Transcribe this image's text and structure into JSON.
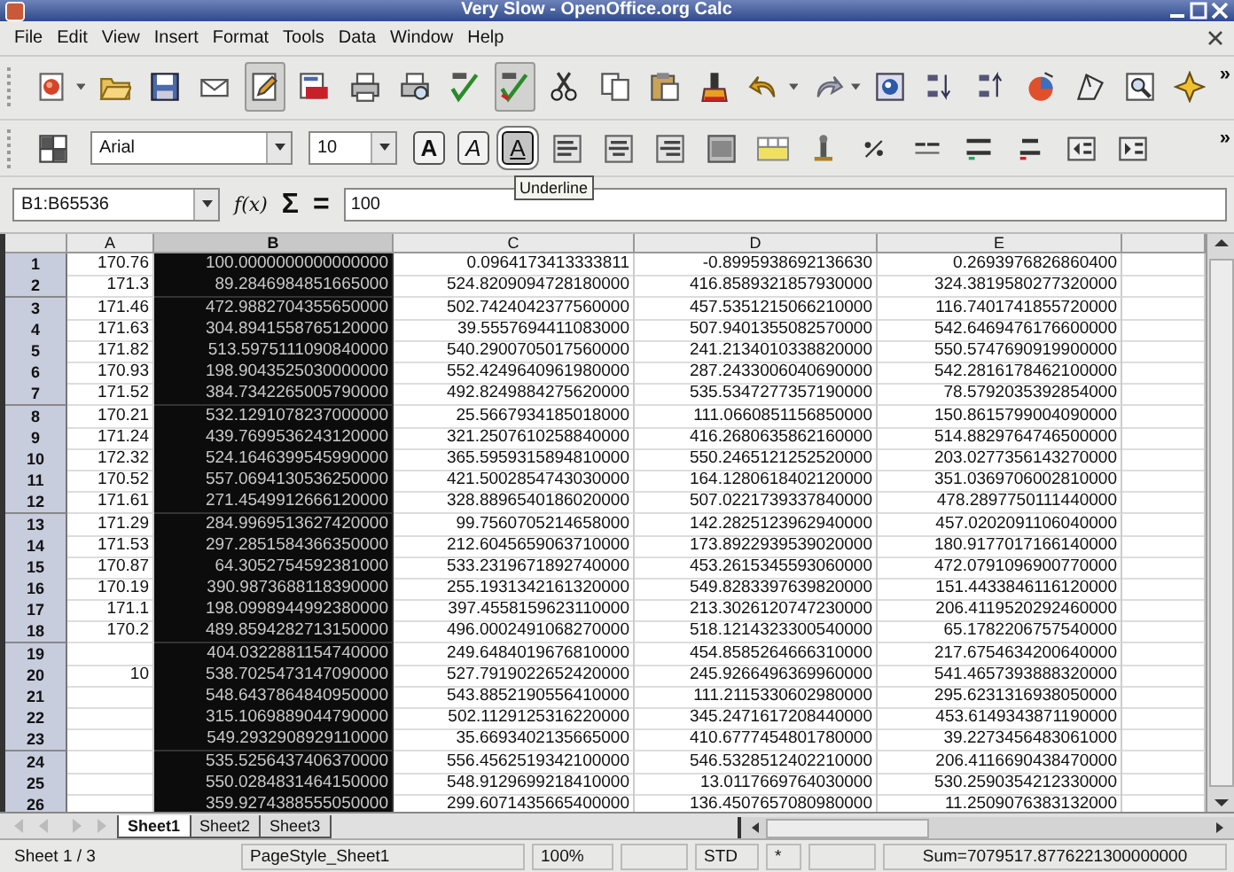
{
  "window": {
    "title": "Very Slow - OpenOffice.org Calc"
  },
  "menu": [
    "File",
    "Edit",
    "View",
    "Insert",
    "Format",
    "Tools",
    "Data",
    "Window",
    "Help"
  ],
  "standard_toolbar": {
    "buttons": [
      {
        "kind": "new",
        "pressed": false,
        "dropdown": true
      },
      {
        "kind": "open",
        "pressed": false,
        "dropdown": false
      },
      {
        "kind": "save",
        "pressed": false,
        "dropdown": false
      },
      {
        "kind": "mail",
        "pressed": false,
        "dropdown": false
      },
      {
        "kind": "edit",
        "pressed": true,
        "dropdown": false
      },
      {
        "kind": "pdf",
        "pressed": false,
        "dropdown": false
      },
      {
        "kind": "print",
        "pressed": false,
        "dropdown": false
      },
      {
        "kind": "preview",
        "pressed": false,
        "dropdown": false
      },
      {
        "kind": "spell",
        "pressed": false,
        "dropdown": false
      },
      {
        "kind": "autospell",
        "pressed": true,
        "dropdown": false
      },
      {
        "kind": "cut",
        "pressed": false,
        "dropdown": false
      },
      {
        "kind": "copy",
        "pressed": false,
        "dropdown": false
      },
      {
        "kind": "paste",
        "pressed": false,
        "dropdown": false
      },
      {
        "kind": "brush",
        "pressed": false,
        "dropdown": false
      },
      {
        "kind": "undo",
        "pressed": false,
        "dropdown": true
      },
      {
        "kind": "redo",
        "pressed": false,
        "dropdown": true
      },
      {
        "kind": "navigator",
        "pressed": false,
        "dropdown": false
      },
      {
        "kind": "sortasc",
        "pressed": false,
        "dropdown": false
      },
      {
        "kind": "sortdesc",
        "pressed": false,
        "dropdown": false
      },
      {
        "kind": "chart",
        "pressed": false,
        "dropdown": false
      },
      {
        "kind": "draw",
        "pressed": false,
        "dropdown": false
      },
      {
        "kind": "find",
        "pressed": false,
        "dropdown": false
      },
      {
        "kind": "gallery",
        "pressed": false,
        "dropdown": false
      }
    ],
    "overflow": "»"
  },
  "formatting_toolbar": {
    "font": "Arial",
    "size": "10",
    "text_buttons": [
      {
        "kind": "bold",
        "label": "A",
        "pressed": false
      },
      {
        "kind": "italic",
        "label": "A",
        "pressed": false
      },
      {
        "kind": "underline",
        "label": "A",
        "pressed": true
      }
    ],
    "buttons": [
      {
        "kind": "alignleft"
      },
      {
        "kind": "aligncenter"
      },
      {
        "kind": "alignright"
      },
      {
        "kind": "justify"
      },
      {
        "kind": "merge"
      },
      {
        "kind": "currency"
      },
      {
        "kind": "percent"
      },
      {
        "kind": "numformat"
      },
      {
        "kind": "adddecimal"
      },
      {
        "kind": "deldecimal"
      },
      {
        "kind": "outdent"
      },
      {
        "kind": "indent"
      }
    ],
    "overflow": "»"
  },
  "tooltip": "Underline",
  "formula_bar": {
    "name_box": "B1:B65536",
    "function_wizard": "f(x)",
    "sum": "Σ",
    "equals": "=",
    "formula": "100"
  },
  "sheet": {
    "columns": [
      {
        "label": "A",
        "selected": false
      },
      {
        "label": "B",
        "selected": true
      },
      {
        "label": "C",
        "selected": false
      },
      {
        "label": "D",
        "selected": false
      },
      {
        "label": "E",
        "selected": false
      }
    ],
    "rows": [
      {
        "header": "1",
        "cells": [
          "170.76",
          "100.0000000000000000",
          "0.0964173413333811",
          "-0.8995938692136630",
          "0.2693976826860400"
        ]
      },
      {
        "header": "2",
        "cells": [
          "171.3",
          "89.2846984851665000",
          "524.8209094728180000",
          "416.8589321857930000",
          "324.3819580277320000"
        ]
      },
      {
        "header": "3",
        "cells": [
          "171.46",
          "472.9882704355650000",
          "502.7424042377560000",
          "457.5351215066210000",
          "116.7401741855720000"
        ]
      },
      {
        "header": "4",
        "cells": [
          "171.63",
          "304.8941558765120000",
          "39.5557694411083000",
          "507.9401355082570000",
          "542.6469476176600000"
        ]
      },
      {
        "header": "5",
        "cells": [
          "171.82",
          "513.5975111090840000",
          "540.2900705017560000",
          "241.2134010338820000",
          "550.5747690919900000"
        ]
      },
      {
        "header": "6",
        "cells": [
          "170.93",
          "198.9043525030000000",
          "552.4249640961980000",
          "287.2433006040690000",
          "542.2816178462100000"
        ]
      },
      {
        "header": "7",
        "cells": [
          "171.52",
          "384.7342265005790000",
          "492.8249884275620000",
          "535.5347277357190000",
          "78.5792035392854000"
        ]
      },
      {
        "header": "8",
        "cells": [
          "170.21",
          "532.1291078237000000",
          "25.5667934185018000",
          "111.0660851156850000",
          "150.8615799004090000"
        ]
      },
      {
        "header": "9",
        "cells": [
          "171.24",
          "439.7699536243120000",
          "321.2507610258840000",
          "416.2680635862160000",
          "514.8829764746500000"
        ]
      },
      {
        "header": "10",
        "cells": [
          "172.32",
          "524.1646399545990000",
          "365.5959315894810000",
          "550.2465121252520000",
          "203.0277356143270000"
        ]
      },
      {
        "header": "11",
        "cells": [
          "170.52",
          "557.0694130536250000",
          "421.5002854743030000",
          "164.1280618402120000",
          "351.0369706002810000"
        ]
      },
      {
        "header": "12",
        "cells": [
          "171.61",
          "271.4549912666120000",
          "328.8896540186020000",
          "507.0221739337840000",
          "478.2897750111440000"
        ]
      },
      {
        "header": "13",
        "cells": [
          "171.29",
          "284.9969513627420000",
          "99.7560705214658000",
          "142.2825123962940000",
          "457.0202091106040000"
        ]
      },
      {
        "header": "14",
        "cells": [
          "171.53",
          "297.2851584366350000",
          "212.6045659063710000",
          "173.8922939539020000",
          "180.9177017166140000"
        ]
      },
      {
        "header": "15",
        "cells": [
          "170.87",
          "64.3052754592381000",
          "533.2319671892740000",
          "453.2615345593060000",
          "472.0791096900770000"
        ]
      },
      {
        "header": "16",
        "cells": [
          "170.19",
          "390.9873688118390000",
          "255.1931342161320000",
          "549.8283397639820000",
          "151.4433846116120000"
        ]
      },
      {
        "header": "17",
        "cells": [
          "171.1",
          "198.0998944992380000",
          "397.4558159623110000",
          "213.3026120747230000",
          "206.4119520292460000"
        ]
      },
      {
        "header": "18",
        "cells": [
          "170.2",
          "489.8594282713150000",
          "496.0002491068270000",
          "518.1214323300540000",
          "65.1782206757540000"
        ]
      },
      {
        "header": "19",
        "cells": [
          null,
          "404.0322881154740000",
          "249.6484019676810000",
          "454.8585264666310000",
          "217.6754634200640000"
        ]
      },
      {
        "header": "20",
        "cells": [
          "10",
          "538.7025473147090000",
          "527.7919022652420000",
          "245.9266496369960000",
          "541.4657393888320000"
        ]
      },
      {
        "header": "21",
        "cells": [
          null,
          "548.6437864840950000",
          "543.8852190556410000",
          "111.2115330602980000",
          "295.6231316938050000"
        ]
      },
      {
        "header": "22",
        "cells": [
          null,
          "315.1069889044790000",
          "502.1129125316220000",
          "345.2471617208440000",
          "453.6149343871190000"
        ]
      },
      {
        "header": "23",
        "cells": [
          null,
          "549.2932908929110000",
          "35.6693402135665000",
          "410.6777454801780000",
          "39.2273456483061000"
        ]
      },
      {
        "header": "24",
        "cells": [
          null,
          "535.5256437406370000",
          "556.4562519342100000",
          "546.5328512402210000",
          "206.4116690438470000"
        ]
      },
      {
        "header": "25",
        "cells": [
          null,
          "550.0284831464150000",
          "548.9129699218410000",
          "13.0117669764030000",
          "530.2590354212330000"
        ]
      },
      {
        "header": "26",
        "cells": [
          null,
          "359.9274388555050000",
          "299.6071435665400000",
          "136.4507657080980000",
          "11.2509076383132000"
        ]
      }
    ]
  },
  "sheet_tabs": [
    {
      "label": "Sheet1",
      "selected": true
    },
    {
      "label": "Sheet2",
      "selected": false
    },
    {
      "label": "Sheet3",
      "selected": false
    }
  ],
  "status_bar": {
    "sheet": "Sheet 1 / 3",
    "page_style": "PageStyle_Sheet1",
    "zoom": "100%",
    "mode": "STD",
    "modified": "*",
    "sum": "Sum=7079517.8776221300000000"
  }
}
